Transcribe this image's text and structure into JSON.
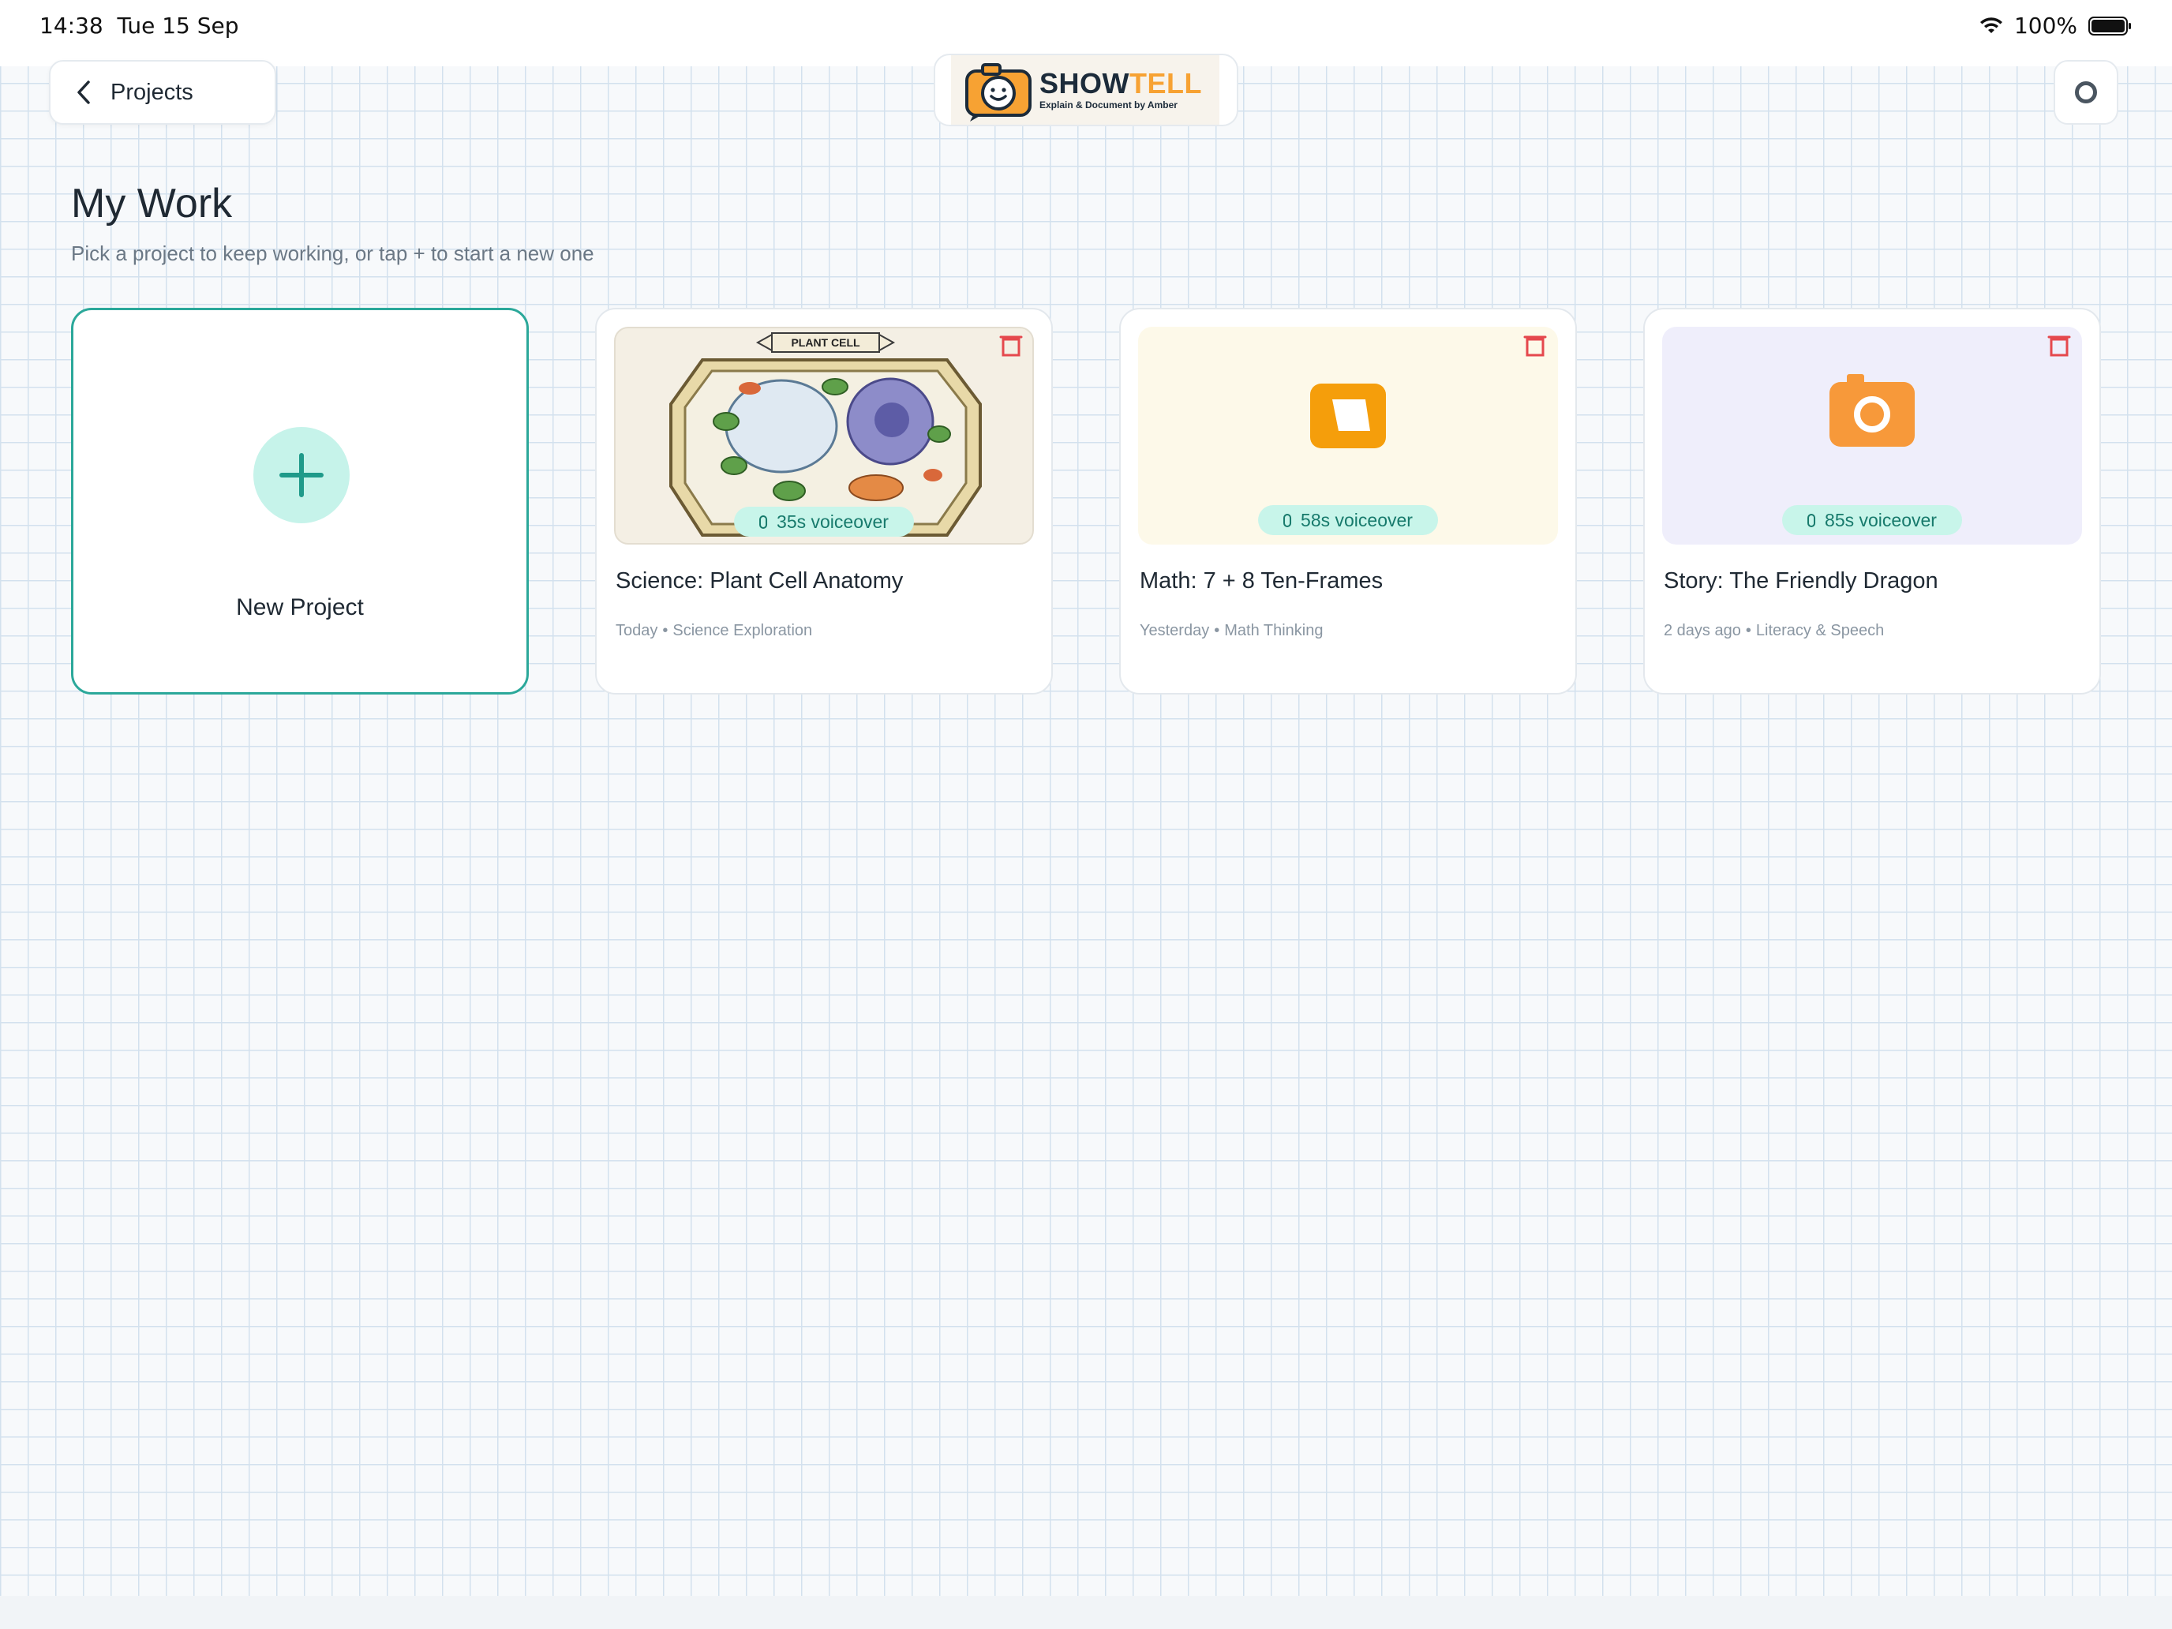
{
  "status_bar": {
    "time": "14:38",
    "date": "Tue 15 Sep",
    "battery": "100%"
  },
  "header": {
    "back_label": "Projects",
    "logo_word_show": "SHOW",
    "logo_word_tell": "TELL",
    "logo_tagline": "Explain & Document by Amber"
  },
  "page": {
    "title": "My Work",
    "subtitle": "Pick a project to keep working, or tap + to start a new one"
  },
  "new_project": {
    "label": "New Project"
  },
  "projects": [
    {
      "title": "Science: Plant Cell Anatomy",
      "when": "Today",
      "category": "Science Exploration",
      "voiceover": "35s voiceover",
      "thumb_banner": "PLANT CELL",
      "icon": "plant-cell-illustration"
    },
    {
      "title": "Math: 7 + 8 Ten-Frames",
      "when": "Yesterday",
      "category": "Math Thinking",
      "voiceover": "58s voiceover",
      "icon": "slides-icon"
    },
    {
      "title": "Story: The Friendly Dragon",
      "when": "2 days ago",
      "category": "Literacy & Speech",
      "voiceover": "85s voiceover",
      "icon": "camera-icon"
    }
  ],
  "colors": {
    "accent_teal": "#2ba89a",
    "badge_bg": "#c8f5ea",
    "orange": "#f7a233",
    "delete_red": "#e5484d"
  },
  "separator": "•"
}
